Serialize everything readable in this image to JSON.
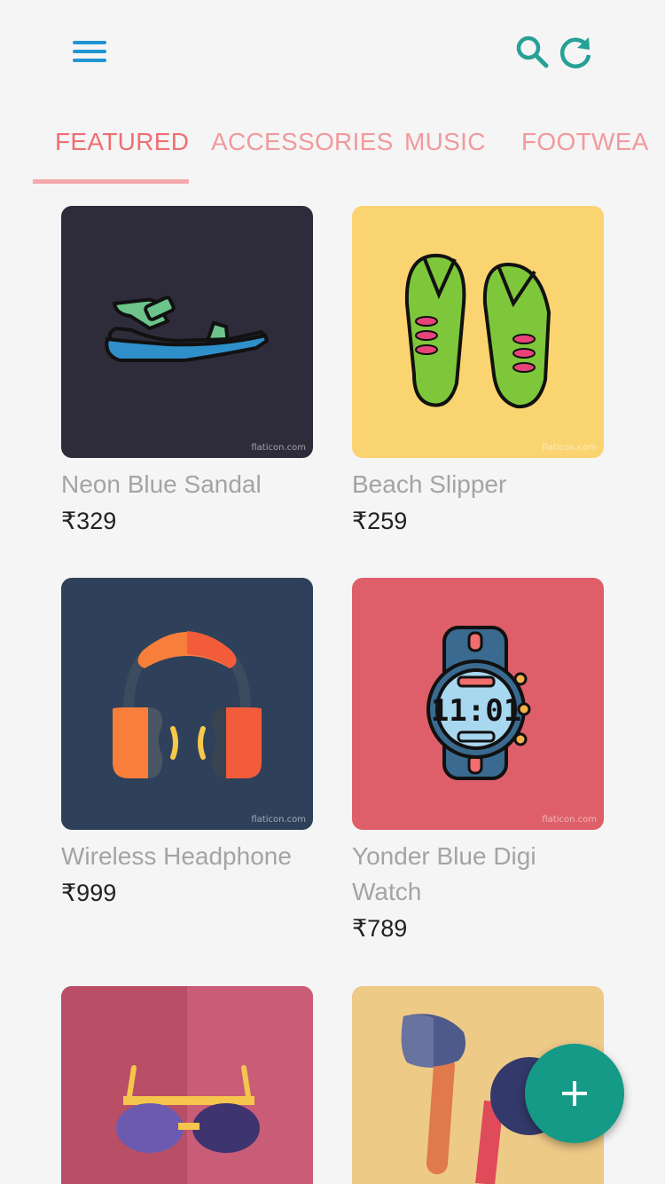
{
  "header": {
    "menu_icon": "hamburger-menu-icon",
    "search_icon": "search-icon",
    "refresh_icon": "refresh-icon",
    "icon_color": "#1f95d3",
    "action_color": "#26a195"
  },
  "tabs": [
    {
      "label": "FEATURED",
      "active": true
    },
    {
      "label": "ACCESSORIES",
      "active": false
    },
    {
      "label": "MUSIC",
      "active": false
    },
    {
      "label": "FOOTWEA",
      "active": false
    }
  ],
  "accent_color": "#ee6f73",
  "products": [
    {
      "name": "Neon Blue Sandal",
      "price": "₹329",
      "image": "sandal-image",
      "bg": "#2e2c3a",
      "watermark": "flaticon.com"
    },
    {
      "name": "Beach Slipper",
      "price": "₹259",
      "image": "slipper-image",
      "bg": "#fad470",
      "watermark": "flaticon.com"
    },
    {
      "name": "Wireless Headphone",
      "price": "₹999",
      "image": "headphone-image",
      "bg": "#2e405a",
      "watermark": "flaticon.com"
    },
    {
      "name": "Yonder Blue Digi Watch",
      "price": "₹789",
      "image": "watch-image",
      "bg": "#de5f69",
      "watermark": "flaticon.com",
      "watch_time": "11:01"
    },
    {
      "name": "",
      "price": "",
      "image": "sunglasses-image",
      "bg": "#c25a74"
    },
    {
      "name": "",
      "price": "",
      "image": "earphones-image",
      "bg": "#eeca87"
    }
  ],
  "fab": {
    "icon": "plus-icon",
    "color": "#149a86"
  }
}
